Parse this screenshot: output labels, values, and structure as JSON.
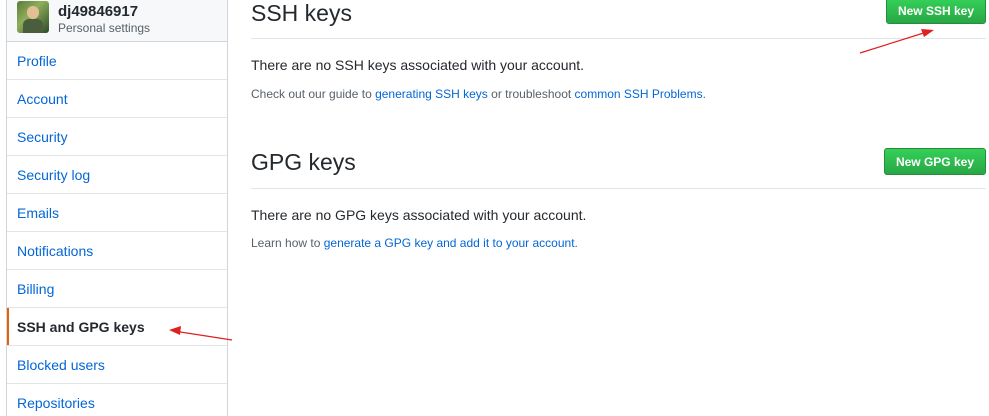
{
  "sidebar": {
    "username": "dj49846917",
    "subtitle": "Personal settings",
    "items": [
      {
        "label": "Profile"
      },
      {
        "label": "Account"
      },
      {
        "label": "Security"
      },
      {
        "label": "Security log"
      },
      {
        "label": "Emails"
      },
      {
        "label": "Notifications"
      },
      {
        "label": "Billing"
      },
      {
        "label": "SSH and GPG keys"
      },
      {
        "label": "Blocked users"
      },
      {
        "label": "Repositories"
      }
    ],
    "selected": "SSH and GPG keys"
  },
  "ssh": {
    "title": "SSH keys",
    "button": "New SSH key",
    "message": "There are no SSH keys associated with your account.",
    "note_prefix": "Check out our guide to ",
    "note_link1": "generating SSH keys",
    "note_middle": " or troubleshoot ",
    "note_link2": "common SSH Problems",
    "note_suffix": "."
  },
  "gpg": {
    "title": "GPG keys",
    "button": "New GPG key",
    "message": "There are no GPG keys associated with your account.",
    "note_prefix": "Learn how to ",
    "note_link": "generate a GPG key and add it to your account",
    "note_suffix": "."
  },
  "colors": {
    "link": "#0366d6",
    "button_green": "#28a745",
    "selected_indicator": "#e36209",
    "annotation_arrow": "#e02020"
  }
}
